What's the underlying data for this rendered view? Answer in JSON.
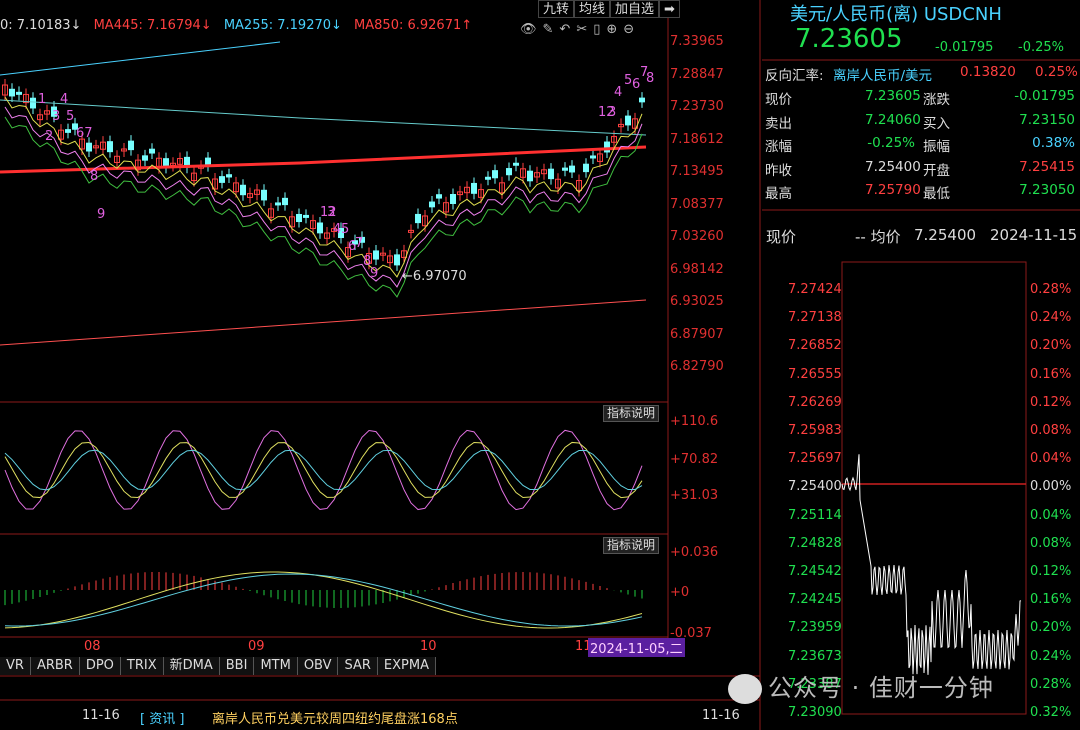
{
  "toolbar": {
    "btn1": "九转",
    "btn2": "均线",
    "btn3": "加自选",
    "btn4": "➡"
  },
  "ma": {
    "ma1": "0: 7.10183↓",
    "ma2": "MA445: 7.16794↓",
    "ma3": "MA255: 7.19270↓",
    "ma4": "MA850: 6.92671↑"
  },
  "main_axis": [
    "7.33965",
    "7.28847",
    "7.23730",
    "7.18612",
    "7.13495",
    "7.08377",
    "7.03260",
    "6.98142",
    "6.93025",
    "6.87907",
    "6.82790"
  ],
  "low_label": "6.97070",
  "nine_labels": [
    "1",
    "2",
    "3",
    "4",
    "5",
    "67",
    "8",
    "9",
    "12",
    "3",
    "4",
    "5",
    "6",
    "7",
    "8",
    "9",
    "12",
    "3",
    "4",
    "5",
    "6",
    "7",
    "8"
  ],
  "ind1": {
    "btn": "指标说明",
    "axis": [
      "+110.6",
      "+70.82",
      "+31.03"
    ]
  },
  "ind2": {
    "btn": "指标说明",
    "axis": [
      "+0.036",
      "+0",
      "-0.037"
    ]
  },
  "xaxis": {
    "m08": "08",
    "m09": "09",
    "m10": "10",
    "m11": "11",
    "cursor_date": "2024-11-05,二"
  },
  "tabs": [
    "VR",
    "ARBR",
    "DPO",
    "TRIX",
    "新DMA",
    "BBI",
    "MTM",
    "OBV",
    "SAR",
    "EXPMA"
  ],
  "news": {
    "date_left": "11-16",
    "tag": "资讯",
    "headline": "离岸人民币兑美元较周四纽约尾盘涨168点",
    "date_right": "11-16"
  },
  "quote": {
    "title": "美元/人民币(离) USDCNH",
    "price": "7.23605",
    "change": "-0.01795",
    "change_pct": "-0.25%",
    "rev_label": "反向汇率:",
    "rev_name": "离岸人民币/美元",
    "rev_value": "0.13820",
    "rev_pct": "0.25%",
    "rows": [
      {
        "l": "现价",
        "lv": "7.23605",
        "r": "涨跌",
        "rv": "-0.01795"
      },
      {
        "l": "卖出",
        "lv": "7.24060",
        "r": "买入",
        "rv": "7.23150"
      },
      {
        "l": "涨幅",
        "lv": "-0.25%",
        "r": "振幅",
        "rv": "0.38%"
      },
      {
        "l": "昨收",
        "lv": "7.25400",
        "r": "开盘",
        "rv": "7.25415"
      },
      {
        "l": "最高",
        "lv": "7.25790",
        "r": "最低",
        "rv": "7.23050"
      }
    ]
  },
  "intraday": {
    "label": "现价",
    "dash": "-- 均价",
    "avg": "7.25400",
    "date": "2024-11-15",
    "left_axis": [
      "7.27424",
      "7.27138",
      "7.26852",
      "7.26555",
      "7.26269",
      "7.25983",
      "7.25697",
      "7.25400",
      "7.25114",
      "7.24828",
      "7.24542",
      "7.24245",
      "7.23959",
      "7.23673",
      "7.23387",
      "7.23090"
    ],
    "right_axis": [
      "0.28%",
      "0.24%",
      "0.20%",
      "0.16%",
      "0.12%",
      "0.08%",
      "0.04%",
      "0.00%",
      "0.04%",
      "0.08%",
      "0.12%",
      "0.16%",
      "0.20%",
      "0.24%",
      "0.28%",
      "0.32%"
    ]
  },
  "watermark": "公众号 · 佳财一分钟",
  "colors": {
    "up": "#ff4040",
    "down": "#20e050",
    "cyan": "#4ad2ff",
    "ma850": "#ff3a3a"
  }
}
